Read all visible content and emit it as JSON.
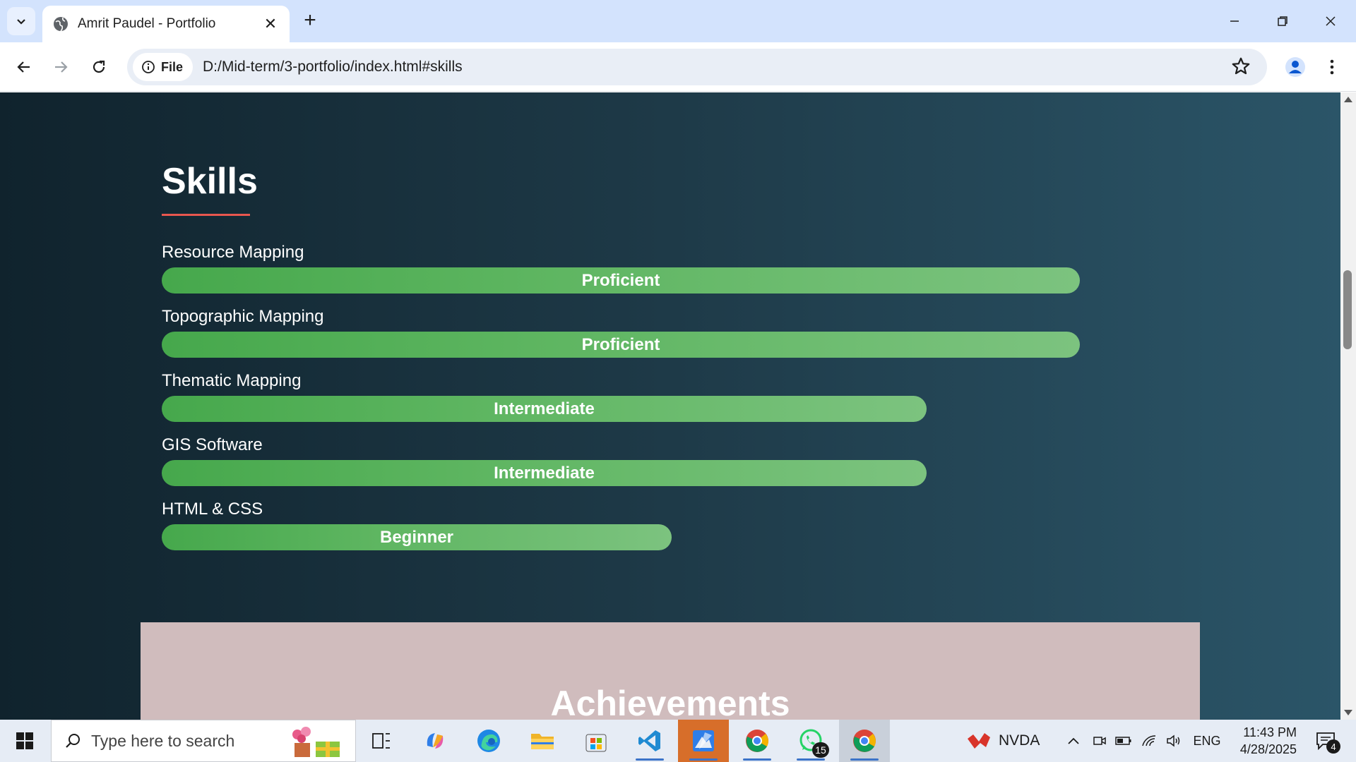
{
  "browser": {
    "tab_title": "Amrit Paudel - Portfolio",
    "address_chip": "File",
    "url": "D:/Mid-term/3-portfolio/index.html#skills"
  },
  "page": {
    "skills": {
      "heading": "Skills",
      "items": [
        {
          "label": "Resource Mapping",
          "level": "Proficient",
          "fill_fraction": 1.0
        },
        {
          "label": "Topographic Mapping",
          "level": "Proficient",
          "fill_fraction": 1.0
        },
        {
          "label": "Thematic Mapping",
          "level": "Intermediate",
          "fill_fraction": 0.8333
        },
        {
          "label": "GIS Software",
          "level": "Intermediate",
          "fill_fraction": 0.8333
        },
        {
          "label": "HTML & CSS",
          "level": "Beginner",
          "fill_fraction": 0.5556
        }
      ]
    },
    "achievements": {
      "heading": "Achievements"
    }
  },
  "taskbar": {
    "search_placeholder": "Type here to search",
    "whatsapp_badge": "15",
    "nvda_label": "NVDA",
    "language": "ENG",
    "time": "11:43 PM",
    "date": "4/28/2025",
    "notification_count": "4"
  },
  "colors": {
    "accent_underline": "#e8574f",
    "bar_green": "#5db560",
    "achievements_bg": "#d0bcbd"
  }
}
